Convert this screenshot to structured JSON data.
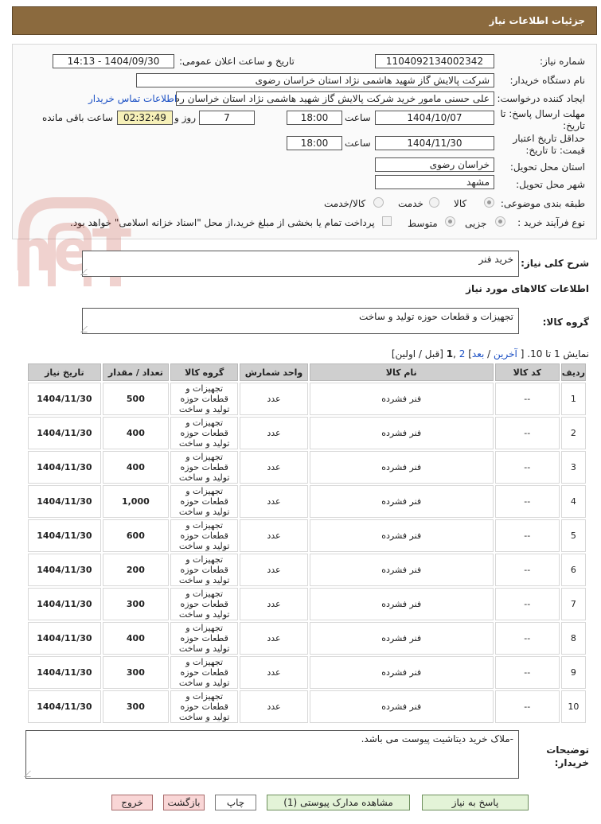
{
  "header": {
    "title": "جزئیات اطلاعات نیاز"
  },
  "form": {
    "need_number_label": "شماره نیاز:",
    "need_number": "1104092134002342",
    "announce_label": "تاریخ و ساعت اعلان عمومی:",
    "announce_value": "1404/09/30 - 14:13",
    "buyer_org_label": "نام دستگاه خریدار:",
    "buyer_org": "شرکت پالایش گاز شهید هاشمی نژاد   استان خراسان رضوی",
    "creator_label": "ایجاد کننده درخواست:",
    "creator": "علی حسنی مامور خرید شرکت پالایش گاز شهید هاشمی نژاد   استان خراسان رضوی",
    "contact_link": "اطلاعات تماس خریدار",
    "deadline_label": "مهلت ارسال پاسخ: تا تاریخ:",
    "deadline_date": "1404/10/07",
    "time_label": "ساعت",
    "deadline_time": "18:00",
    "days_value": "7",
    "days_label": "روز و",
    "remaining_value": "02:32:49",
    "remaining_label": "ساعت باقی مانده",
    "validity_label": "حداقل تاریخ اعتبار قیمت: تا تاریخ:",
    "validity_date": "1404/11/30",
    "validity_time": "18:00",
    "province_label": "استان محل تحویل:",
    "province": "خراسان رضوی",
    "city_label": "شهر محل تحویل:",
    "city": "مشهد",
    "category_label": "طبقه بندی موضوعی:",
    "category_options": [
      "کالا",
      "خدمت",
      "کالا/خدمت"
    ],
    "category_selected": "کالا",
    "process_label": "نوع فرآیند خرید :",
    "process_options": [
      "جزیی",
      "متوسط"
    ],
    "process_selected": "جزیی",
    "treasury_text": "پرداخت تمام یا بخشی از مبلغ خرید،از محل \"اسناد خزانه اسلامی\" خواهد بود."
  },
  "summary": {
    "label": "شرح کلی نیاز:",
    "value": "خرید فنر"
  },
  "goods_info_title": "اطلاعات کالاهای مورد نیاز",
  "goods_group": {
    "label": "گروه کالا:",
    "value": "تجهیزات و قطعات حوزه تولید و ساخت"
  },
  "pager": {
    "prefix": "نمایش 1 تا 10.",
    "bracket_open": "[",
    "last": "آخرین",
    "sep": "/",
    "next": "بعد",
    "bracket_close": "]",
    "page2": "2",
    "comma": ",",
    "page1": "1",
    "tail": "[قبل / اولین]"
  },
  "table": {
    "headers": [
      "ردیف",
      "کد کالا",
      "نام کالا",
      "واحد شمارش",
      "گروه کالا",
      "تعداد / مقدار",
      "تاریخ نیاز"
    ],
    "rows": [
      {
        "row": "1",
        "code": "--",
        "name": "فنر فشرده",
        "unit": "عدد",
        "group": "تجهیزات و قطعات حوزه تولید و ساخت",
        "qty": "500",
        "date": "1404/11/30"
      },
      {
        "row": "2",
        "code": "--",
        "name": "فنر فشرده",
        "unit": "عدد",
        "group": "تجهیزات و قطعات حوزه تولید و ساخت",
        "qty": "400",
        "date": "1404/11/30"
      },
      {
        "row": "3",
        "code": "--",
        "name": "فنر فشرده",
        "unit": "عدد",
        "group": "تجهیزات و قطعات حوزه تولید و ساخت",
        "qty": "400",
        "date": "1404/11/30"
      },
      {
        "row": "4",
        "code": "--",
        "name": "فنر فشرده",
        "unit": "عدد",
        "group": "تجهیزات و قطعات حوزه تولید و ساخت",
        "qty": "1,000",
        "date": "1404/11/30"
      },
      {
        "row": "5",
        "code": "--",
        "name": "فنر فشرده",
        "unit": "عدد",
        "group": "تجهیزات و قطعات حوزه تولید و ساخت",
        "qty": "600",
        "date": "1404/11/30"
      },
      {
        "row": "6",
        "code": "--",
        "name": "فنر فشرده",
        "unit": "عدد",
        "group": "تجهیزات و قطعات حوزه تولید و ساخت",
        "qty": "200",
        "date": "1404/11/30"
      },
      {
        "row": "7",
        "code": "--",
        "name": "فنر فشرده",
        "unit": "عدد",
        "group": "تجهیزات و قطعات حوزه تولید و ساخت",
        "qty": "300",
        "date": "1404/11/30"
      },
      {
        "row": "8",
        "code": "--",
        "name": "فنر فشرده",
        "unit": "عدد",
        "group": "تجهیزات و قطعات حوزه تولید و ساخت",
        "qty": "400",
        "date": "1404/11/30"
      },
      {
        "row": "9",
        "code": "--",
        "name": "فنر فشرده",
        "unit": "عدد",
        "group": "تجهیزات و قطعات حوزه تولید و ساخت",
        "qty": "300",
        "date": "1404/11/30"
      },
      {
        "row": "10",
        "code": "--",
        "name": "فنر فشرده",
        "unit": "عدد",
        "group": "تجهیزات و قطعات حوزه تولید و ساخت",
        "qty": "300",
        "date": "1404/11/30"
      }
    ]
  },
  "notes": {
    "label_line1": "توضیحات",
    "label_line2": "خریدار:",
    "value": "-ملاک خرید دیتاشیت پیوست می باشد."
  },
  "buttons": {
    "reply": "پاسخ به نیاز",
    "attachments": "مشاهده مدارک پیوستی (1)",
    "print": "چاپ",
    "back": "بازگشت",
    "exit": "خروج"
  },
  "watermark": {
    "text": "AriaTender.neT",
    "color": "#c0392b"
  }
}
